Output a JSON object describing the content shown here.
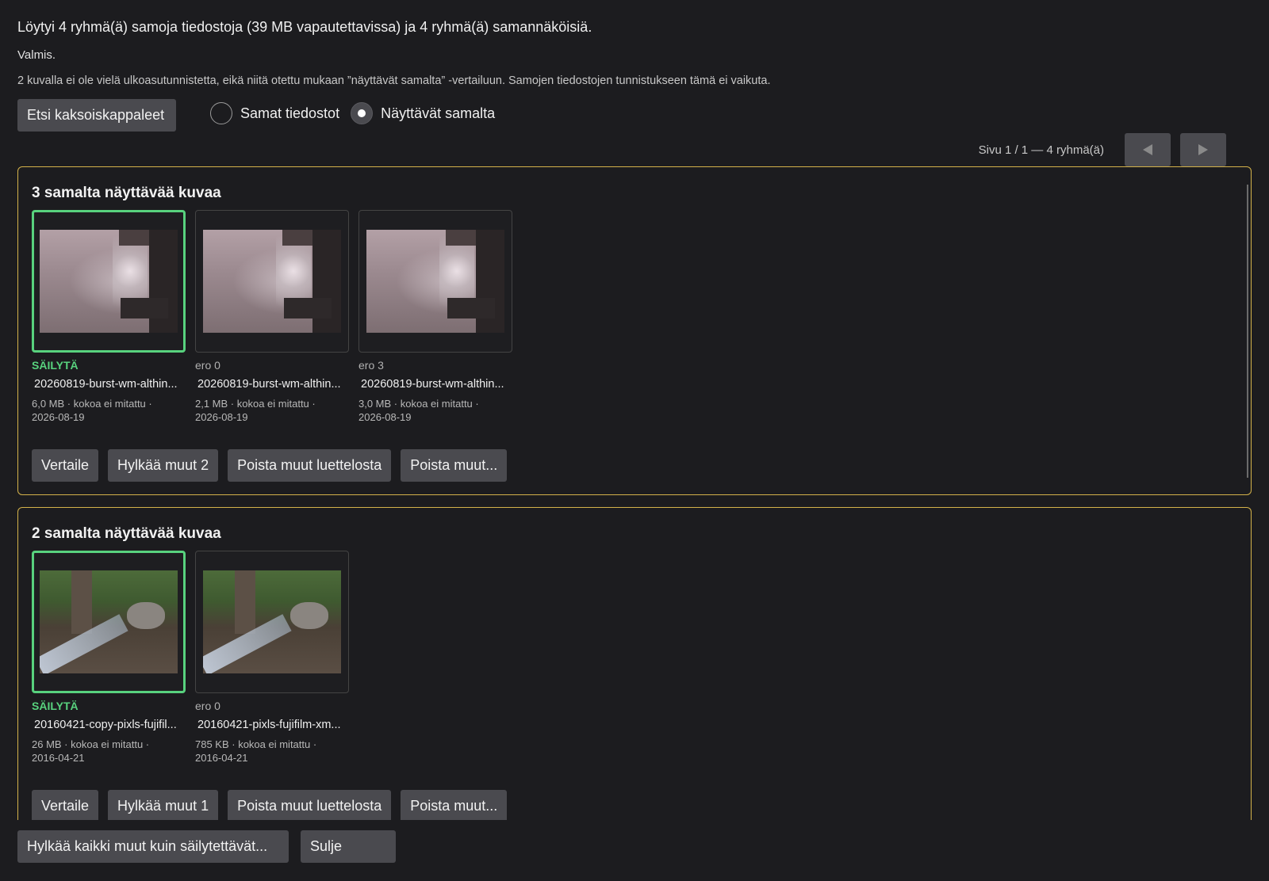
{
  "summary": "Löytyi 4 ryhmä(ä) samoja tiedostoja (39 MB vapautettavissa) ja 4 ryhmä(ä) samannäköisiä.",
  "status": "Valmis.",
  "note": "2 kuvalla ei ole vielä ulkoasutunnistetta, eikä niitä otettu mukaan ”näyttävät samalta” -vertailuun. Samojen tiedostojen tunnistukseen tämä ei vaikuta.",
  "find_button": "Etsi kaksoiskappaleet",
  "mode": {
    "options": [
      "Samat tiedostot",
      "Näyttävät samalta"
    ],
    "selected": "Näyttävät samalta"
  },
  "pager": {
    "text": "Sivu 1 / 1 — 4 ryhmä(ä)",
    "prev_icon": "chevron-left-icon",
    "next_icon": "chevron-right-icon"
  },
  "groups": [
    {
      "title": "3 samalta näyttävää kuvaa",
      "items": [
        {
          "label": "SÄILYTÄ",
          "keep": true,
          "filename": "20260819-burst-wm-althin...",
          "meta": "6,0 MB · kokoa ei mitattu · 2026-08-19"
        },
        {
          "label": "ero 0",
          "keep": false,
          "filename": "20260819-burst-wm-althin...",
          "meta": "2,1 MB · kokoa ei mitattu · 2026-08-19"
        },
        {
          "label": "ero 3",
          "keep": false,
          "filename": "20260819-burst-wm-althin...",
          "meta": "3,0 MB · kokoa ei mitattu · 2026-08-19"
        }
      ],
      "actions": [
        "Vertaile",
        "Hylkää muut 2",
        "Poista muut luettelosta",
        "Poista muut..."
      ]
    },
    {
      "title": "2 samalta näyttävää kuvaa",
      "items": [
        {
          "label": "SÄILYTÄ",
          "keep": true,
          "filename": "20160421-copy-pixls-fujifil...",
          "meta": "26 MB · kokoa ei mitattu · 2016-04-21"
        },
        {
          "label": "ero 0",
          "keep": false,
          "filename": "20160421-pixls-fujifilm-xm...",
          "meta": "785 KB · kokoa ei mitattu · 2016-04-21"
        }
      ],
      "actions": [
        "Vertaile",
        "Hylkää muut 1",
        "Poista muut luettelosta",
        "Poista muut..."
      ]
    }
  ],
  "footer": {
    "reject_all": "Hylkää kaikki muut kuin säilytettävät...",
    "close": "Sulje"
  },
  "colors": {
    "background": "#1c1c1f",
    "group_border": "#d4b24a",
    "keep_accent": "#58d27e",
    "button": "#4a4a4f"
  }
}
